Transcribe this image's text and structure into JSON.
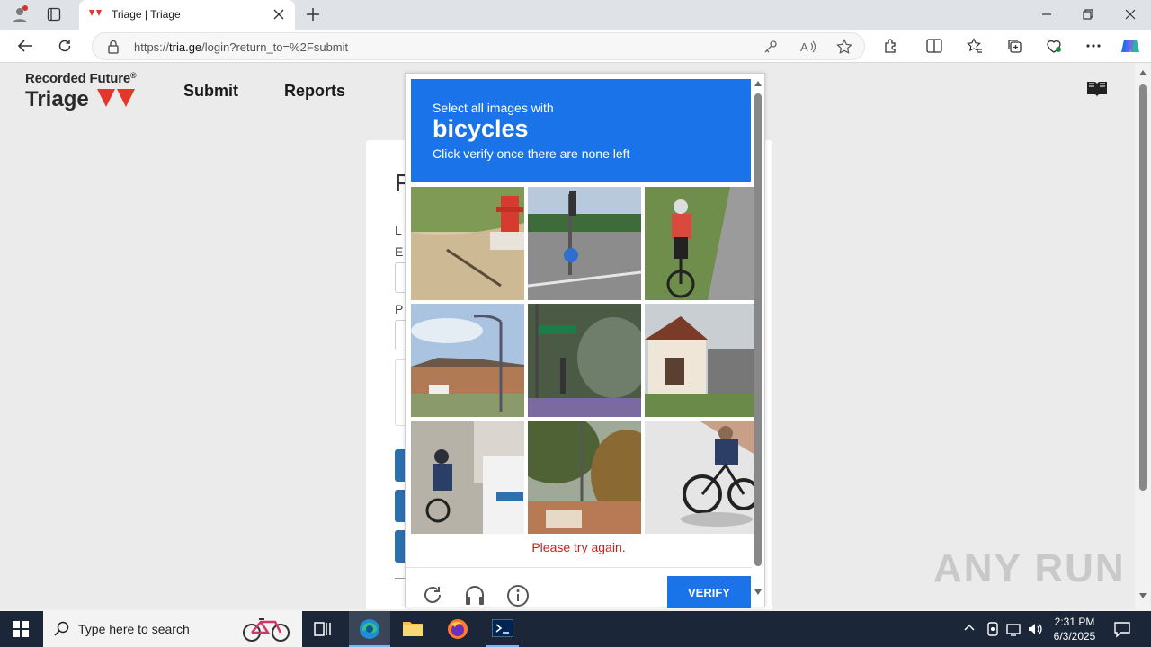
{
  "browser": {
    "tab_title": "Triage | Triage",
    "url_prefix": "https://",
    "url_host": "tria.ge",
    "url_path": "/login?return_to=%2Fsubmit"
  },
  "site": {
    "brand_top": "Recorded Future",
    "brand_mark": "®",
    "brand_bottom": "Triage",
    "nav": [
      "Submit",
      "Reports"
    ]
  },
  "login_partial": {
    "heading_glyph": "F",
    "label_1": "L",
    "label_2": "E",
    "label_3": "P"
  },
  "captcha": {
    "prompt": "Select all images with",
    "target": "bicycles",
    "hint": "Click verify once there are none left",
    "error": "Please try again.",
    "verify_label": "VERIFY",
    "tiles": [
      "fire hydrant",
      "street sign",
      "cyclist",
      "street light",
      "street sign",
      "house",
      "cyclist",
      "street light",
      "cyclist"
    ]
  },
  "watermark": "ANY RUN",
  "taskbar": {
    "search_placeholder": "Type here to search",
    "time": "2:31 PM",
    "date": "6/3/2025"
  },
  "colors": {
    "captcha_blue": "#1a73e8",
    "error_red": "#c5221f",
    "brand_red": "#e2372b",
    "taskbar": "#1b2638"
  }
}
